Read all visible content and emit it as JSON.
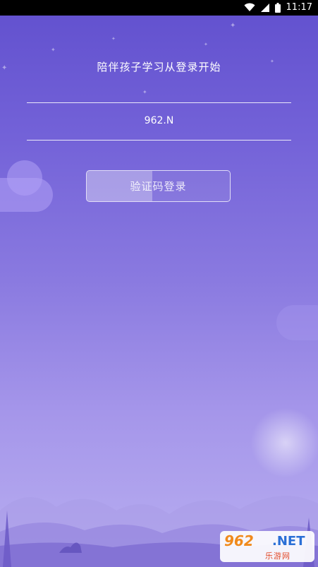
{
  "status_bar": {
    "time": "11:17",
    "icons": [
      "wifi-icon",
      "cellular-icon",
      "battery-icon"
    ]
  },
  "login": {
    "headline": "陪伴孩子学习从登录开始",
    "input_value": "962.N",
    "button_label": "验证码登录",
    "button_fill_fraction": 0.46
  },
  "watermark": {
    "number": "962",
    "domain": ".NET",
    "subtitle": "乐游网"
  },
  "colors": {
    "background_top": "#6352cf",
    "background_bottom": "#b8aef0"
  }
}
